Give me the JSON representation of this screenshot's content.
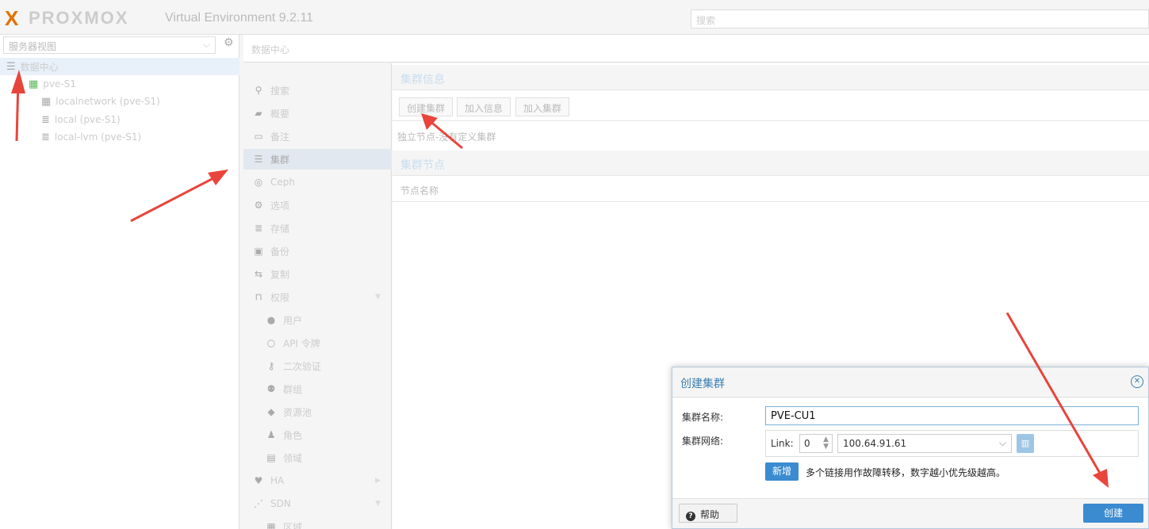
{
  "header": {
    "logo_mark": "X",
    "logo_text": "PROXMOX",
    "version": "Virtual Environment 9.2.11",
    "search_placeholder": "搜索"
  },
  "tree": {
    "view_select": "服务器视图",
    "items": [
      {
        "label": "数据中心",
        "icon": "datacenter-icon"
      },
      {
        "label": "pve-S1",
        "icon": "node-online-icon"
      },
      {
        "label": "localnetwork (pve-S1)",
        "icon": "grid-icon"
      },
      {
        "label": "local (pve-S1)",
        "icon": "storage-icon"
      },
      {
        "label": "local-lvm (pve-S1)",
        "icon": "storage-icon"
      }
    ]
  },
  "breadcrumb": "数据中心",
  "nav": {
    "items": [
      {
        "label": "搜索",
        "icon": "search-icon",
        "glyph": "⚲"
      },
      {
        "label": "概要",
        "icon": "book-icon",
        "glyph": "▰"
      },
      {
        "label": "备注",
        "icon": "note-icon",
        "glyph": "▭"
      },
      {
        "label": "集群",
        "icon": "cluster-icon",
        "glyph": "☰"
      },
      {
        "label": "Ceph",
        "icon": "ceph-icon",
        "glyph": "◎"
      },
      {
        "label": "选项",
        "icon": "gear-icon",
        "glyph": "⚙"
      },
      {
        "label": "存储",
        "icon": "database-icon",
        "glyph": "≣"
      },
      {
        "label": "备份",
        "icon": "floppy-icon",
        "glyph": "▣"
      },
      {
        "label": "复制",
        "icon": "retweet-icon",
        "glyph": "⇆"
      },
      {
        "label": "权限",
        "icon": "unlock-icon",
        "glyph": "⊓"
      },
      {
        "label": "用户",
        "icon": "user-icon",
        "glyph": "●"
      },
      {
        "label": "API 令牌",
        "icon": "user-outline-icon",
        "glyph": "○"
      },
      {
        "label": "二次验证",
        "icon": "key-icon",
        "glyph": "⚷"
      },
      {
        "label": "群组",
        "icon": "users-icon",
        "glyph": "⚉"
      },
      {
        "label": "资源池",
        "icon": "tags-icon",
        "glyph": "◆"
      },
      {
        "label": "角色",
        "icon": "male-icon",
        "glyph": "♟"
      },
      {
        "label": "领域",
        "icon": "address-book-icon",
        "glyph": "▤"
      },
      {
        "label": "HA",
        "icon": "heartbeat-icon",
        "glyph": "♥"
      },
      {
        "label": "SDN",
        "icon": "sdn-icon",
        "glyph": "⋰"
      },
      {
        "label": "区域",
        "icon": "grid-icon",
        "glyph": "▦"
      }
    ]
  },
  "main": {
    "cluster_info_title": "集群信息",
    "btn_create": "创建集群",
    "btn_join_info": "加入信息",
    "btn_join": "加入集群",
    "standalone_text": "独立节点-没有定义集群",
    "cluster_nodes_title": "集群节点",
    "col_node_name": "节点名称"
  },
  "dialog": {
    "title": "创建集群",
    "name_label": "集群名称:",
    "name_value": "PVE-CU1",
    "network_label": "集群网络:",
    "link_label": "Link:",
    "link_value": "0",
    "address_value": "100.64.91.61",
    "add_button": "新增",
    "hint": "多个链接用作故障转移，数字越小优先级越高。",
    "help_button": "帮助",
    "create_button": "创建"
  },
  "colors": {
    "accent": "#3b8bd0",
    "annotation_arrow": "#e8453c",
    "logo_orange": "#e57000"
  }
}
